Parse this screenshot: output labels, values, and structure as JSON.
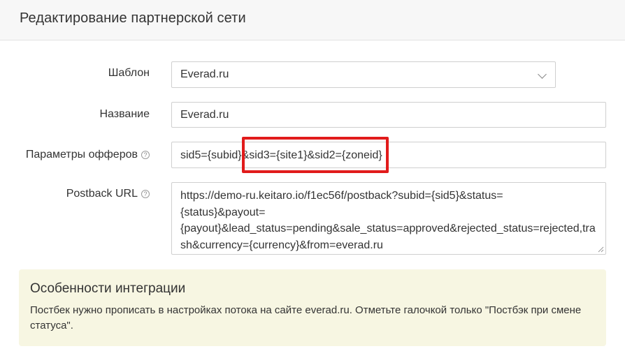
{
  "header": {
    "title": "Редактирование партнерской сети"
  },
  "form": {
    "template": {
      "label": "Шаблон",
      "value": "Everad.ru"
    },
    "name": {
      "label": "Название",
      "value": "Everad.ru"
    },
    "offer_params": {
      "label": "Параметры офферов",
      "value": "sid5={subid}&sid3={site1}&sid2={zoneid}"
    },
    "postback": {
      "label": "Postback URL",
      "value": "https://demo-ru.keitaro.io/f1ec56f/postback?subid={sid5}&status=\n{status}&payout=\n{payout}&lead_status=pending&sale_status=approved&rejected_status=rejected,tra\nsh&currency={currency}&from=everad.ru"
    }
  },
  "help_glyph": "?",
  "notice": {
    "title": "Особенности интеграции",
    "text": "Постбек нужно прописать в настройках потока на сайте everad.ru. Отметьте галочкой только \"Постбэк при смене статуса\"."
  },
  "colors": {
    "highlight": "#e11b1b",
    "notice_bg": "#f7f6e2",
    "header_bg": "#f7f7f7"
  },
  "icons": [
    "chevron-down-icon",
    "help-icon",
    "resize-grip-icon"
  ]
}
